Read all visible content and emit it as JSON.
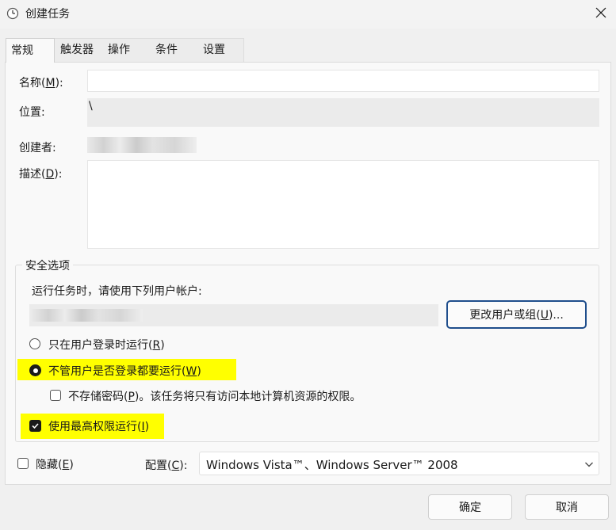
{
  "window": {
    "title": "创建任务",
    "icon": "clock-icon",
    "close_icon": "close-icon"
  },
  "tabs": [
    {
      "label": "常规",
      "active": true
    },
    {
      "label": "触发器",
      "active": false
    },
    {
      "label": "操作",
      "active": false
    },
    {
      "label": "条件",
      "active": false
    },
    {
      "label": "设置",
      "active": false
    }
  ],
  "general": {
    "name_label": "名称(M):",
    "name_value": "",
    "location_label": "位置:",
    "location_value": "\\",
    "author_label": "创建者:",
    "description_label": "描述(D):",
    "description_value": ""
  },
  "security": {
    "group_title": "安全选项",
    "run_as_prompt": "运行任务时，请使用下列用户帐户:",
    "change_user_button": "更改用户或组(U)...",
    "radio_logged_on_only": "只在用户登录时运行(R)",
    "radio_logged_on_or_not": "不管用户是否登录都要运行(W)",
    "checkbox_no_store_password": "不存储密码(P)。该任务将只有访问本地计算机资源的权限。",
    "checkbox_highest_privileges": "使用最高权限运行(I)",
    "radio_logged_on_only_selected": false,
    "radio_logged_on_or_not_selected": true,
    "no_store_password_checked": false,
    "highest_privileges_checked": true,
    "highlight_color": "#ffff00"
  },
  "bottom": {
    "hidden_label": "隐藏(E)",
    "hidden_checked": false,
    "configure_label": "配置(C):",
    "configure_value": "Windows Vista™、Windows Server™ 2008"
  },
  "buttons": {
    "ok": "确定",
    "cancel": "取消"
  },
  "colors": {
    "accent_dark": "#1a1a1a",
    "focus_border": "#1f4e8c"
  }
}
